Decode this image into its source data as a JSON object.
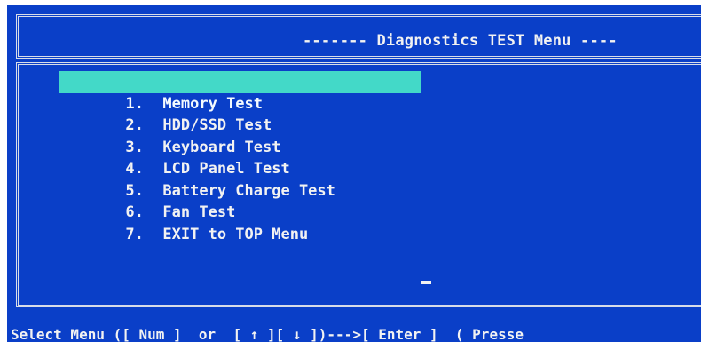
{
  "header": {
    "title": "------- Diagnostics TEST Menu ----"
  },
  "menu": {
    "items": [
      {
        "number": "1.",
        "label": "Memory Test",
        "selected": true
      },
      {
        "number": "2.",
        "label": "HDD/SSD Test",
        "selected": false
      },
      {
        "number": "3.",
        "label": "Keyboard Test",
        "selected": false
      },
      {
        "number": "4.",
        "label": "LCD Panel Test",
        "selected": false
      },
      {
        "number": "5.",
        "label": "Battery Charge Test",
        "selected": false
      },
      {
        "number": "6.",
        "label": "Fan Test",
        "selected": false
      },
      {
        "number": "7.",
        "label": "EXIT to TOP Menu",
        "selected": false
      }
    ],
    "highlight_color": "#43d9c8"
  },
  "status_bar": {
    "text": "Select Menu ([ Num ]  or  [ ↑ ][ ↓ ])--->[ Enter ]  ( Presse"
  },
  "colors": {
    "background": "#0a3fc8",
    "text": "#f2f2f2",
    "frame": "#d8dde8"
  }
}
